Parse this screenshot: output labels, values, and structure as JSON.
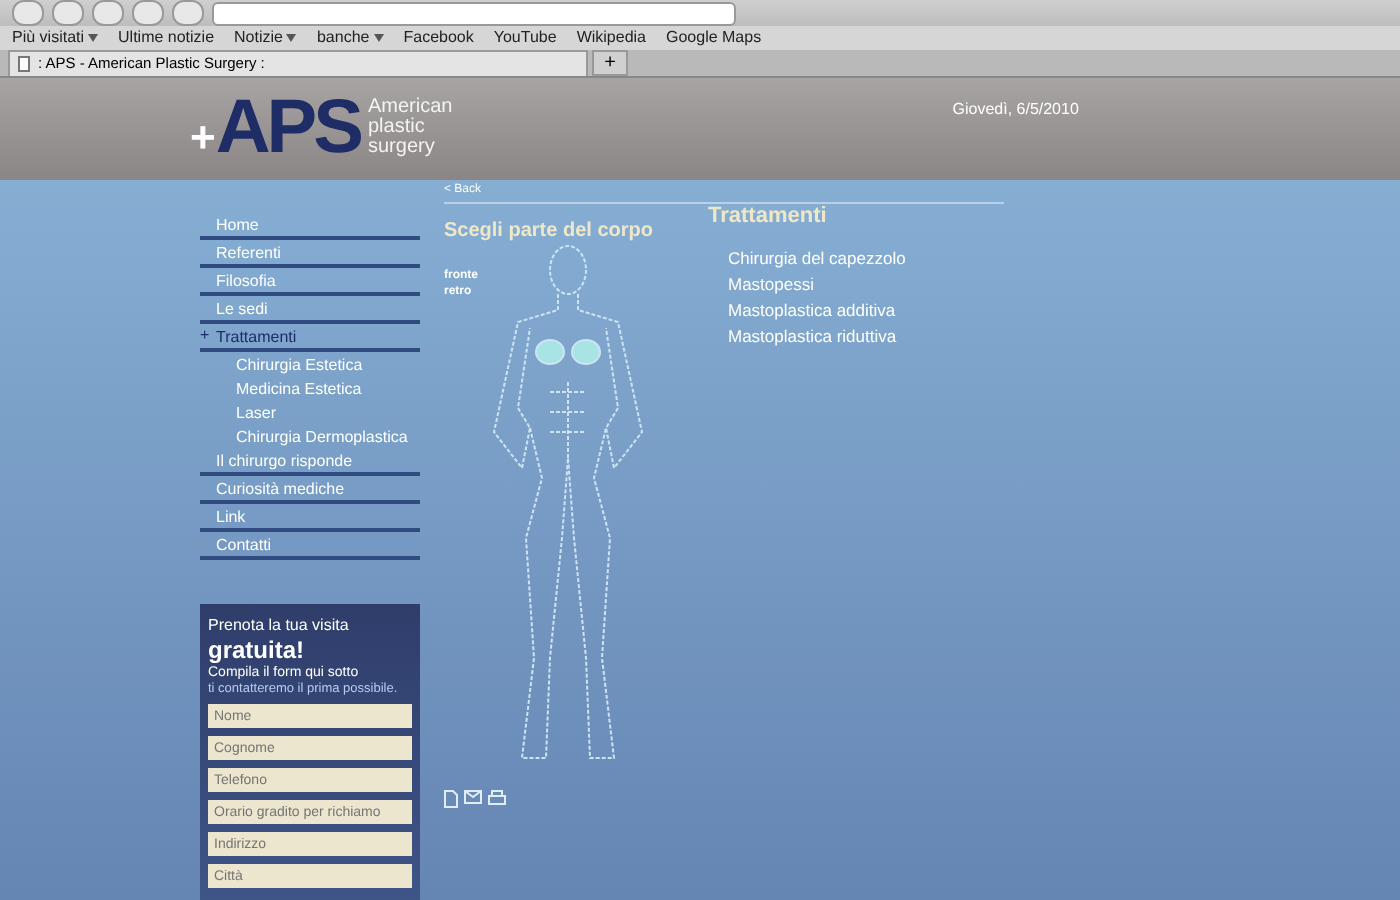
{
  "browser": {
    "bookmarks": [
      {
        "label": "Più visitati",
        "dropdown": true
      },
      {
        "label": "Ultime notizie",
        "dropdown": false
      },
      {
        "label": "Notizie",
        "dropdown": true
      },
      {
        "label": "banche",
        "dropdown": true
      },
      {
        "label": "Facebook",
        "dropdown": false
      },
      {
        "label": "YouTube",
        "dropdown": false
      },
      {
        "label": "Wikipedia",
        "dropdown": false
      },
      {
        "label": "Google Maps",
        "dropdown": false
      }
    ],
    "tab": {
      "title": ": APS - American Plastic Surgery :"
    },
    "new_tab": "+"
  },
  "header": {
    "logo": "APS",
    "logo_plus": "+",
    "tagline": [
      "American",
      "plastic",
      "surgery"
    ],
    "date": "Giovedì, 6/5/2010"
  },
  "menu": [
    {
      "label": "Home",
      "selected": false
    },
    {
      "label": "Referenti",
      "selected": false
    },
    {
      "label": "Filosofia",
      "selected": false
    },
    {
      "label": "Le sedi",
      "selected": false
    },
    {
      "label": "Trattamenti",
      "selected": true,
      "marker": "+",
      "children": [
        {
          "label": "Chirurgia Estetica"
        },
        {
          "label": "Medicina Estetica"
        },
        {
          "label": "Laser"
        },
        {
          "label": "Chirurgia Dermoplastica"
        }
      ]
    },
    {
      "label": "Il chirurgo risponde",
      "selected": false
    },
    {
      "label": "Curiosità mediche",
      "selected": false
    },
    {
      "label": "Link",
      "selected": false
    },
    {
      "label": "Contatti",
      "selected": false
    }
  ],
  "booking": {
    "line1": "Prenota la tua visita",
    "headline": "gratuita!",
    "line2": "Compila il form qui sotto",
    "line3": "ti contatteremo il prima possibile.",
    "fields": [
      {
        "placeholder": "Nome"
      },
      {
        "placeholder": "Cognome"
      },
      {
        "placeholder": "Telefono"
      },
      {
        "placeholder": "Orario gradito per richiamo"
      },
      {
        "placeholder": "Indirizzo"
      },
      {
        "placeholder": "Città"
      }
    ]
  },
  "back_link": "< Back",
  "body_panel": {
    "title": "Scegli parte del corpo",
    "views": [
      {
        "label": "fronte"
      },
      {
        "label": "retro"
      }
    ],
    "highlighted": true
  },
  "treatments": {
    "title": "Trattamenti",
    "items": [
      "Chirurgia del capezzolo",
      "Mastopessi",
      "Mastoplastica additiva",
      "Mastoplastica riduttiva"
    ]
  }
}
